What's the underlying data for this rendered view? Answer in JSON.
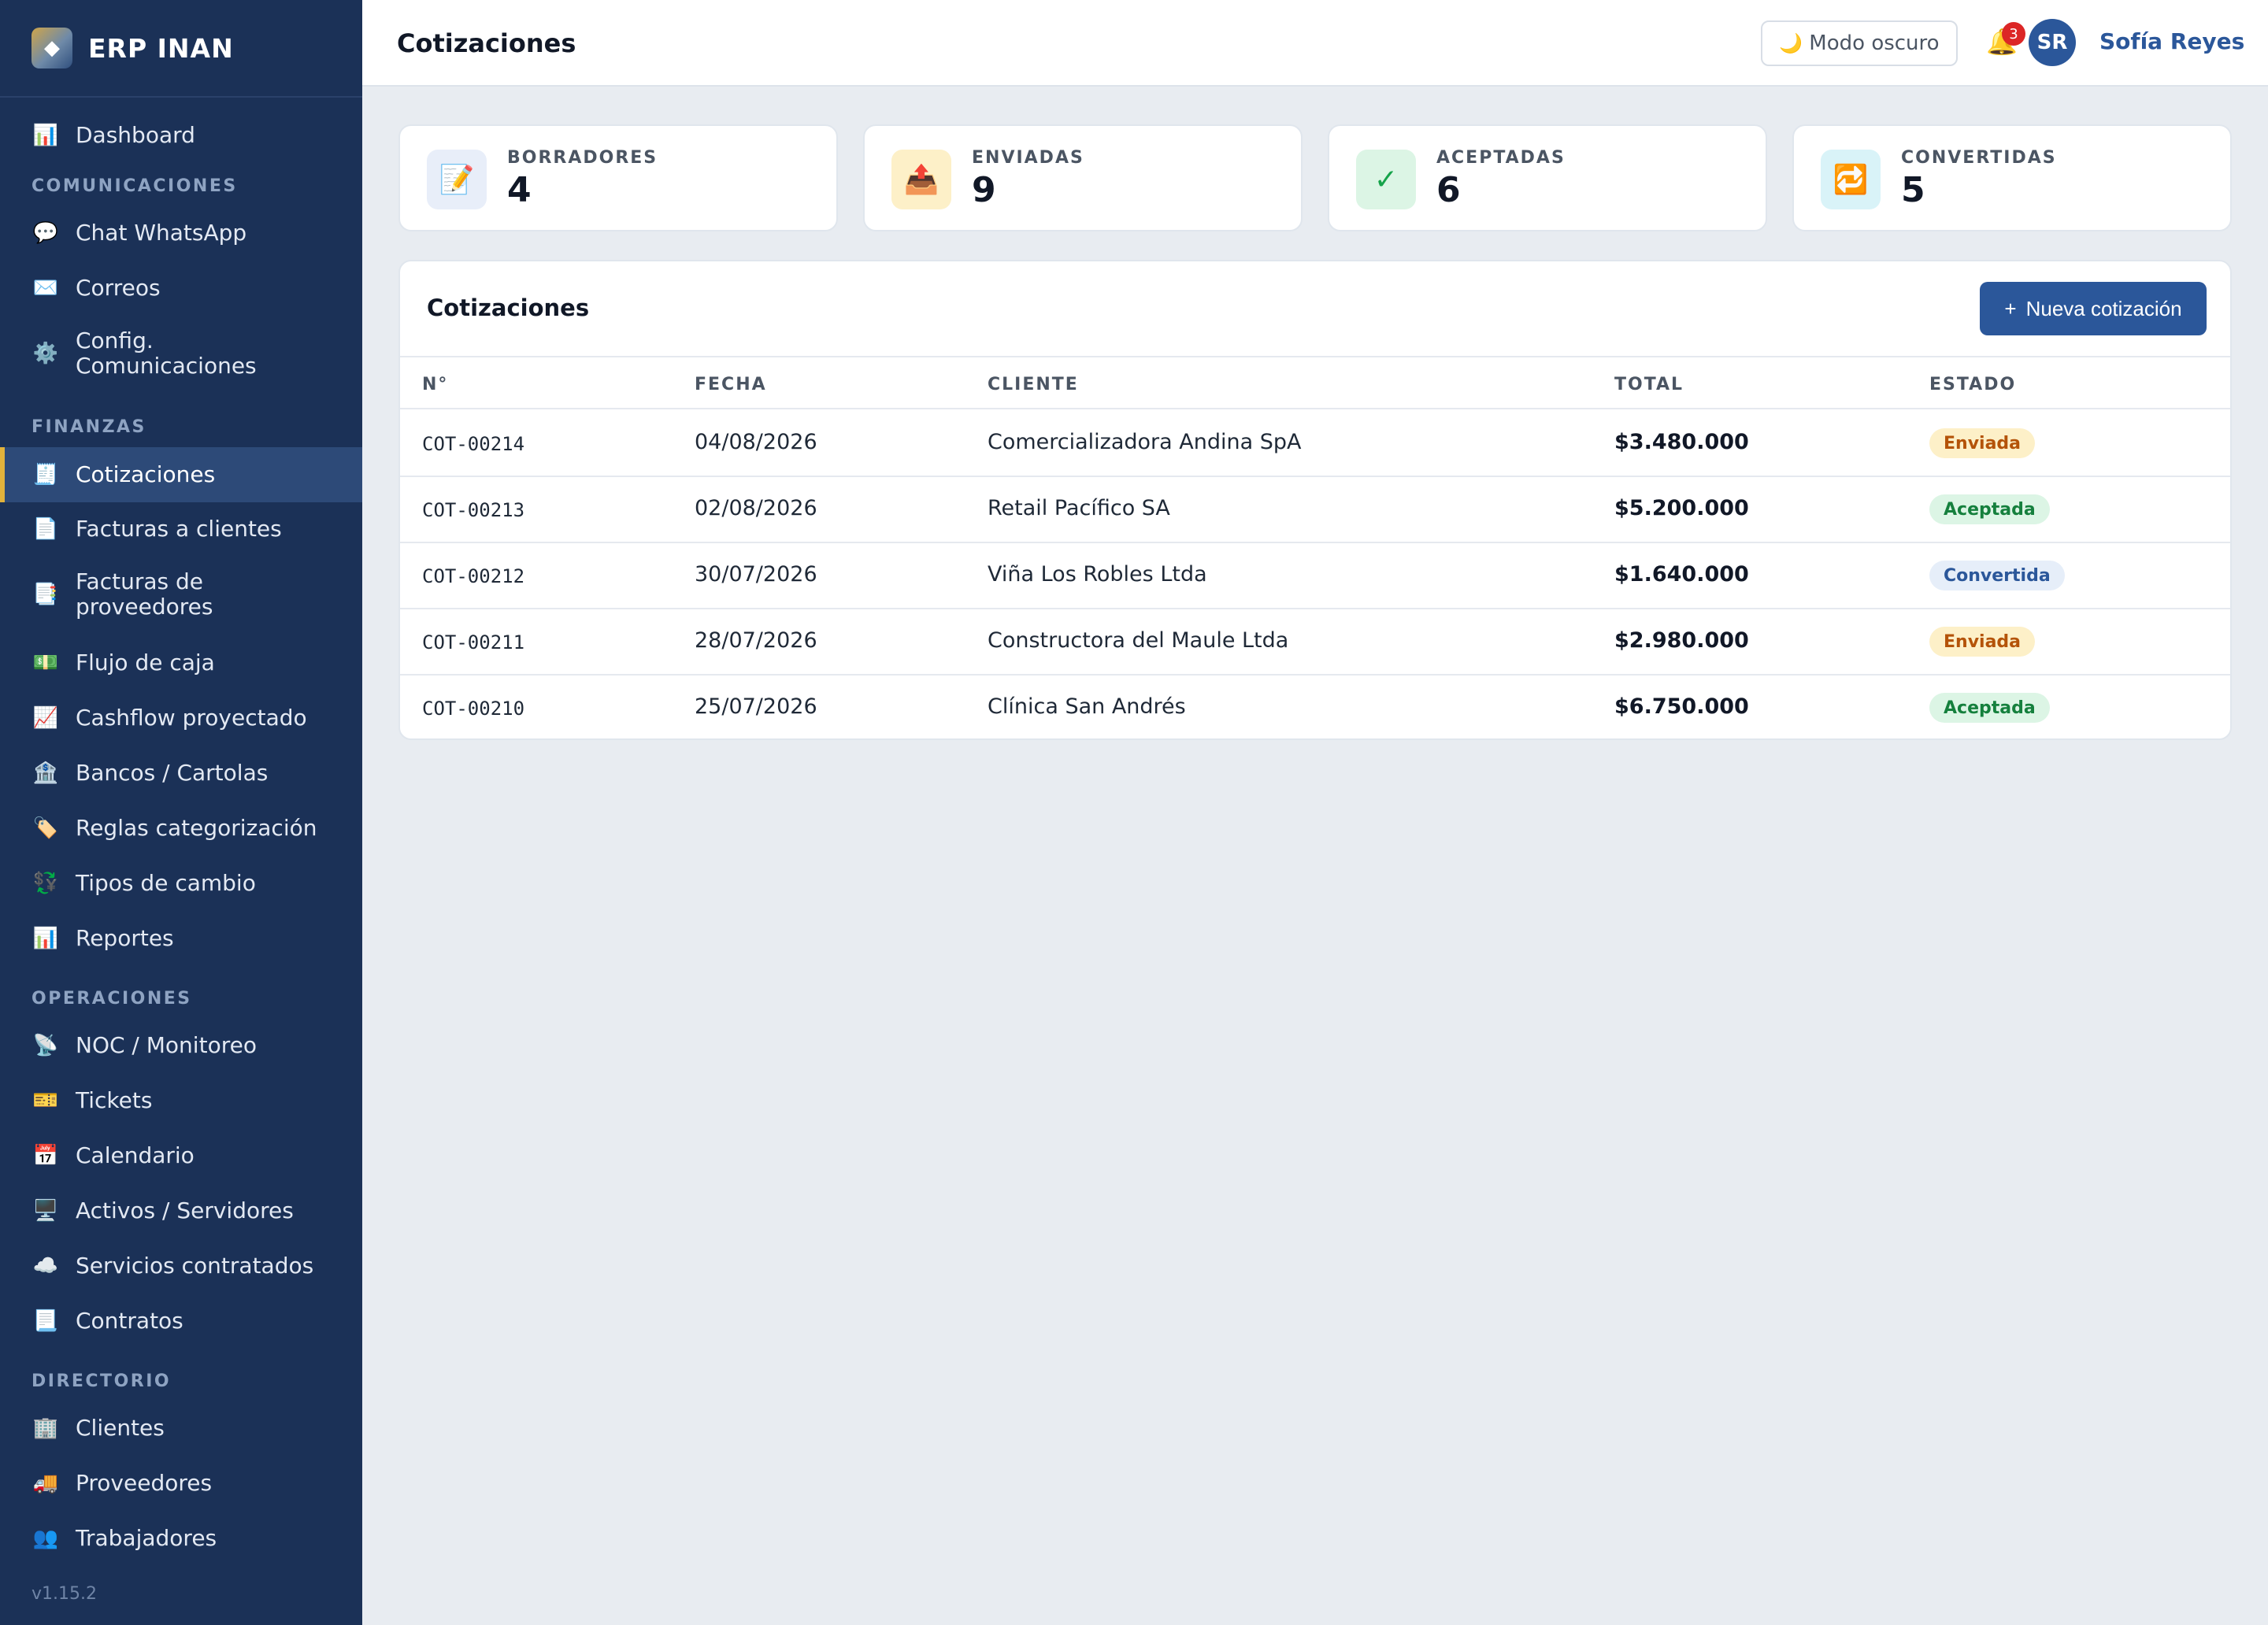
{
  "brand": {
    "name": "ERP INAN",
    "logo_icon": "diamond-icon"
  },
  "sidebar": {
    "top_items": [
      {
        "label": "Dashboard",
        "icon": "📊",
        "icon_name": "dashboard-icon"
      }
    ],
    "sections": [
      {
        "title": "COMUNICACIONES",
        "items": [
          {
            "label": "Chat WhatsApp",
            "icon": "💬",
            "icon_name": "chat-icon"
          },
          {
            "label": "Correos",
            "icon": "✉️",
            "icon_name": "mail-icon"
          },
          {
            "label": "Config.\nComunicaciones",
            "icon": "⚙️",
            "icon_name": "gear-icon"
          }
        ]
      },
      {
        "title": "FINANZAS",
        "items": [
          {
            "label": "Cotizaciones",
            "icon": "🧾",
            "icon_name": "receipt-icon",
            "active": true
          },
          {
            "label": "Facturas a clientes",
            "icon": "📄",
            "icon_name": "document-icon"
          },
          {
            "label": "Facturas de\nproveedores",
            "icon": "📑",
            "icon_name": "documents-icon"
          },
          {
            "label": "Flujo de caja",
            "icon": "💵",
            "icon_name": "cash-icon"
          },
          {
            "label": "Cashflow proyectado",
            "icon": "📈",
            "icon_name": "chart-up-icon"
          },
          {
            "label": "Bancos / Cartolas",
            "icon": "🏦",
            "icon_name": "bank-icon"
          },
          {
            "label": "Reglas categorización",
            "icon": "🏷️",
            "icon_name": "tag-icon"
          },
          {
            "label": "Tipos de cambio",
            "icon": "💱",
            "icon_name": "exchange-icon"
          },
          {
            "label": "Reportes",
            "icon": "📊",
            "icon_name": "report-icon"
          }
        ]
      },
      {
        "title": "OPERACIONES",
        "items": [
          {
            "label": "NOC / Monitoreo",
            "icon": "📡",
            "icon_name": "antenna-icon"
          },
          {
            "label": "Tickets",
            "icon": "🎫",
            "icon_name": "ticket-icon"
          },
          {
            "label": "Calendario",
            "icon": "📅",
            "icon_name": "calendar-icon"
          },
          {
            "label": "Activos / Servidores",
            "icon": "🖥️",
            "icon_name": "computer-icon"
          },
          {
            "label": "Servicios contratados",
            "icon": "☁️",
            "icon_name": "cloud-icon"
          },
          {
            "label": "Contratos",
            "icon": "📃",
            "icon_name": "contract-icon"
          }
        ]
      },
      {
        "title": "DIRECTORIO",
        "items": [
          {
            "label": "Clientes",
            "icon": "🏢",
            "icon_name": "building-icon"
          },
          {
            "label": "Proveedores",
            "icon": "🚚",
            "icon_name": "truck-icon"
          },
          {
            "label": "Trabajadores",
            "icon": "👥",
            "icon_name": "people-icon"
          }
        ]
      }
    ],
    "version": "v1.15.2"
  },
  "topbar": {
    "title": "Cotizaciones",
    "dark_mode_label": "Modo oscuro",
    "dark_mode_icon": "🌙",
    "notifications_count": "3",
    "bell_icon": "🔔",
    "avatar_initials": "SR",
    "user_name": "Sofía Reyes"
  },
  "stats": [
    {
      "label": "BORRADORES",
      "value": "4",
      "icon": "📝",
      "icon_name": "memo-icon",
      "bg": "#e8eef9"
    },
    {
      "label": "ENVIADAS",
      "value": "9",
      "icon": "📤",
      "icon_name": "outbox-icon",
      "bg": "#fdf0c8"
    },
    {
      "label": "ACEPTADAS",
      "value": "6",
      "icon": "✓",
      "icon_name": "check-icon",
      "bg": "#dcf5e5",
      "fg": "#16a34a"
    },
    {
      "label": "CONVERTIDAS",
      "value": "5",
      "icon": "🔁",
      "icon_name": "repeat-icon",
      "bg": "#d9f3f8"
    }
  ],
  "table": {
    "title": "Cotizaciones",
    "new_button_label": "Nueva cotización",
    "columns": [
      "N°",
      "FECHA",
      "CLIENTE",
      "TOTAL",
      "ESTADO"
    ],
    "rows": [
      {
        "number": "COT-00214",
        "date": "04/08/2026",
        "client": "Comercializadora Andina SpA",
        "total": "$3.480.000",
        "status": "Enviada"
      },
      {
        "number": "COT-00213",
        "date": "02/08/2026",
        "client": "Retail Pacífico SA",
        "total": "$5.200.000",
        "status": "Aceptada"
      },
      {
        "number": "COT-00212",
        "date": "30/07/2026",
        "client": "Viña Los Robles Ltda",
        "total": "$1.640.000",
        "status": "Convertida"
      },
      {
        "number": "COT-00211",
        "date": "28/07/2026",
        "client": "Constructora del Maule Ltda",
        "total": "$2.980.000",
        "status": "Enviada"
      },
      {
        "number": "COT-00210",
        "date": "25/07/2026",
        "client": "Clínica San Andrés",
        "total": "$6.750.000",
        "status": "Aceptada"
      }
    ]
  },
  "status_colors": {
    "Enviada": {
      "bg": "#fdf0c8",
      "fg": "#b45309"
    },
    "Aceptada": {
      "bg": "#dcf5e5",
      "fg": "#15803d"
    },
    "Convertida": {
      "bg": "#e6eef9",
      "fg": "#2b579a"
    }
  },
  "colors": {
    "accent": "#2b579a",
    "sidebar_bg": "#1b3157",
    "active_marker": "#e1b23c"
  }
}
